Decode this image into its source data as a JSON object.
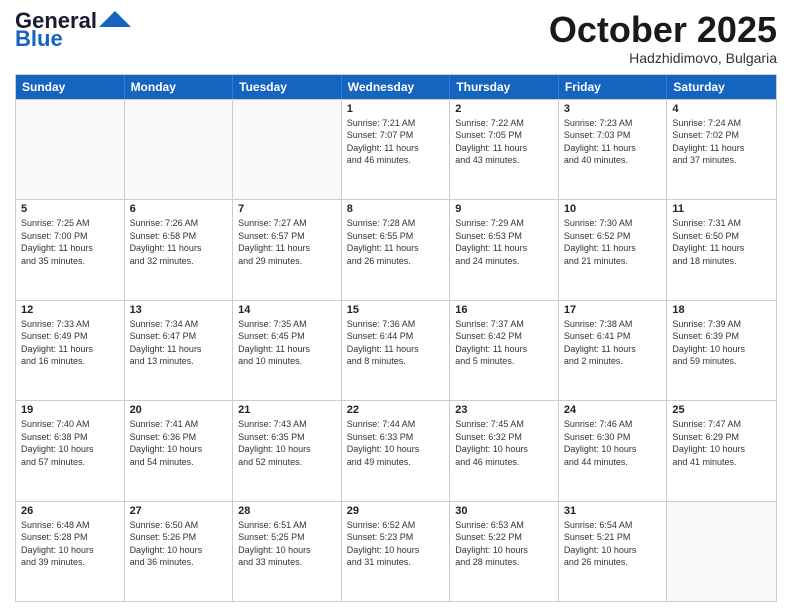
{
  "logo": {
    "line1": "General",
    "line2": "Blue"
  },
  "title": "October 2025",
  "location": "Hadzhidimovo, Bulgaria",
  "weekdays": [
    "Sunday",
    "Monday",
    "Tuesday",
    "Wednesday",
    "Thursday",
    "Friday",
    "Saturday"
  ],
  "weeks": [
    [
      {
        "day": "",
        "info": ""
      },
      {
        "day": "",
        "info": ""
      },
      {
        "day": "",
        "info": ""
      },
      {
        "day": "1",
        "info": "Sunrise: 7:21 AM\nSunset: 7:07 PM\nDaylight: 11 hours\nand 46 minutes."
      },
      {
        "day": "2",
        "info": "Sunrise: 7:22 AM\nSunset: 7:05 PM\nDaylight: 11 hours\nand 43 minutes."
      },
      {
        "day": "3",
        "info": "Sunrise: 7:23 AM\nSunset: 7:03 PM\nDaylight: 11 hours\nand 40 minutes."
      },
      {
        "day": "4",
        "info": "Sunrise: 7:24 AM\nSunset: 7:02 PM\nDaylight: 11 hours\nand 37 minutes."
      }
    ],
    [
      {
        "day": "5",
        "info": "Sunrise: 7:25 AM\nSunset: 7:00 PM\nDaylight: 11 hours\nand 35 minutes."
      },
      {
        "day": "6",
        "info": "Sunrise: 7:26 AM\nSunset: 6:58 PM\nDaylight: 11 hours\nand 32 minutes."
      },
      {
        "day": "7",
        "info": "Sunrise: 7:27 AM\nSunset: 6:57 PM\nDaylight: 11 hours\nand 29 minutes."
      },
      {
        "day": "8",
        "info": "Sunrise: 7:28 AM\nSunset: 6:55 PM\nDaylight: 11 hours\nand 26 minutes."
      },
      {
        "day": "9",
        "info": "Sunrise: 7:29 AM\nSunset: 6:53 PM\nDaylight: 11 hours\nand 24 minutes."
      },
      {
        "day": "10",
        "info": "Sunrise: 7:30 AM\nSunset: 6:52 PM\nDaylight: 11 hours\nand 21 minutes."
      },
      {
        "day": "11",
        "info": "Sunrise: 7:31 AM\nSunset: 6:50 PM\nDaylight: 11 hours\nand 18 minutes."
      }
    ],
    [
      {
        "day": "12",
        "info": "Sunrise: 7:33 AM\nSunset: 6:49 PM\nDaylight: 11 hours\nand 16 minutes."
      },
      {
        "day": "13",
        "info": "Sunrise: 7:34 AM\nSunset: 6:47 PM\nDaylight: 11 hours\nand 13 minutes."
      },
      {
        "day": "14",
        "info": "Sunrise: 7:35 AM\nSunset: 6:45 PM\nDaylight: 11 hours\nand 10 minutes."
      },
      {
        "day": "15",
        "info": "Sunrise: 7:36 AM\nSunset: 6:44 PM\nDaylight: 11 hours\nand 8 minutes."
      },
      {
        "day": "16",
        "info": "Sunrise: 7:37 AM\nSunset: 6:42 PM\nDaylight: 11 hours\nand 5 minutes."
      },
      {
        "day": "17",
        "info": "Sunrise: 7:38 AM\nSunset: 6:41 PM\nDaylight: 11 hours\nand 2 minutes."
      },
      {
        "day": "18",
        "info": "Sunrise: 7:39 AM\nSunset: 6:39 PM\nDaylight: 10 hours\nand 59 minutes."
      }
    ],
    [
      {
        "day": "19",
        "info": "Sunrise: 7:40 AM\nSunset: 6:38 PM\nDaylight: 10 hours\nand 57 minutes."
      },
      {
        "day": "20",
        "info": "Sunrise: 7:41 AM\nSunset: 6:36 PM\nDaylight: 10 hours\nand 54 minutes."
      },
      {
        "day": "21",
        "info": "Sunrise: 7:43 AM\nSunset: 6:35 PM\nDaylight: 10 hours\nand 52 minutes."
      },
      {
        "day": "22",
        "info": "Sunrise: 7:44 AM\nSunset: 6:33 PM\nDaylight: 10 hours\nand 49 minutes."
      },
      {
        "day": "23",
        "info": "Sunrise: 7:45 AM\nSunset: 6:32 PM\nDaylight: 10 hours\nand 46 minutes."
      },
      {
        "day": "24",
        "info": "Sunrise: 7:46 AM\nSunset: 6:30 PM\nDaylight: 10 hours\nand 44 minutes."
      },
      {
        "day": "25",
        "info": "Sunrise: 7:47 AM\nSunset: 6:29 PM\nDaylight: 10 hours\nand 41 minutes."
      }
    ],
    [
      {
        "day": "26",
        "info": "Sunrise: 6:48 AM\nSunset: 5:28 PM\nDaylight: 10 hours\nand 39 minutes."
      },
      {
        "day": "27",
        "info": "Sunrise: 6:50 AM\nSunset: 5:26 PM\nDaylight: 10 hours\nand 36 minutes."
      },
      {
        "day": "28",
        "info": "Sunrise: 6:51 AM\nSunset: 5:25 PM\nDaylight: 10 hours\nand 33 minutes."
      },
      {
        "day": "29",
        "info": "Sunrise: 6:52 AM\nSunset: 5:23 PM\nDaylight: 10 hours\nand 31 minutes."
      },
      {
        "day": "30",
        "info": "Sunrise: 6:53 AM\nSunset: 5:22 PM\nDaylight: 10 hours\nand 28 minutes."
      },
      {
        "day": "31",
        "info": "Sunrise: 6:54 AM\nSunset: 5:21 PM\nDaylight: 10 hours\nand 26 minutes."
      },
      {
        "day": "",
        "info": ""
      }
    ]
  ]
}
